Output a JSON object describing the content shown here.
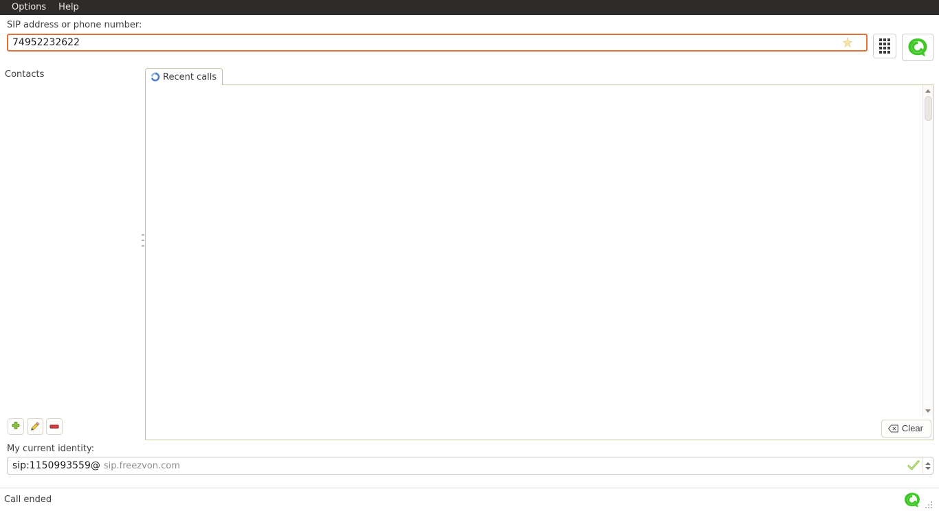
{
  "menubar": {
    "items": [
      {
        "label": "Options",
        "name": "menu-options"
      },
      {
        "label": "Help",
        "name": "menu-help"
      }
    ]
  },
  "address": {
    "label": "SIP address or phone number:",
    "value": "74952232622",
    "placeholder": "SIP address or phone number",
    "favorite_icon": "star-icon",
    "border_color": "#e2703a"
  },
  "toolbar": {
    "dialpad_icon": "dialpad-icon",
    "dialpad_tooltip": "Show dialpad",
    "call_icon": "call-icon",
    "call_tooltip": "Start call",
    "call_color": "#3fc728"
  },
  "contacts": {
    "title": "Contacts",
    "buttons": [
      {
        "name": "add-contact-button",
        "icon": "plus-icon",
        "label": "Add"
      },
      {
        "name": "edit-contact-button",
        "icon": "pencil-icon",
        "label": "Edit"
      },
      {
        "name": "remove-contact-button",
        "icon": "minus-icon",
        "label": "Remove"
      }
    ],
    "items": []
  },
  "tabs": [
    {
      "label": "Recent calls",
      "icon": "history-icon",
      "active": true
    }
  ],
  "recent_calls": {
    "rows": [],
    "clear_label": "Clear",
    "clear_icon": "backspace-icon"
  },
  "identity": {
    "label": "My current identity:",
    "user": "sip:1150993559@",
    "domain": "sip.freezvon.com",
    "valid_icon": "check-icon",
    "spinner_icon": "spinner-arrows-icon"
  },
  "statusbar": {
    "message": "Call ended",
    "call_status_icon": "call-icon",
    "resize_grip_icon": "resize-grip-icon"
  },
  "colors": {
    "menubar_bg": "#2e2c2b",
    "accent_orange": "#e2703a",
    "frame_khaki": "#c9c59b",
    "green": "#3fc728"
  }
}
